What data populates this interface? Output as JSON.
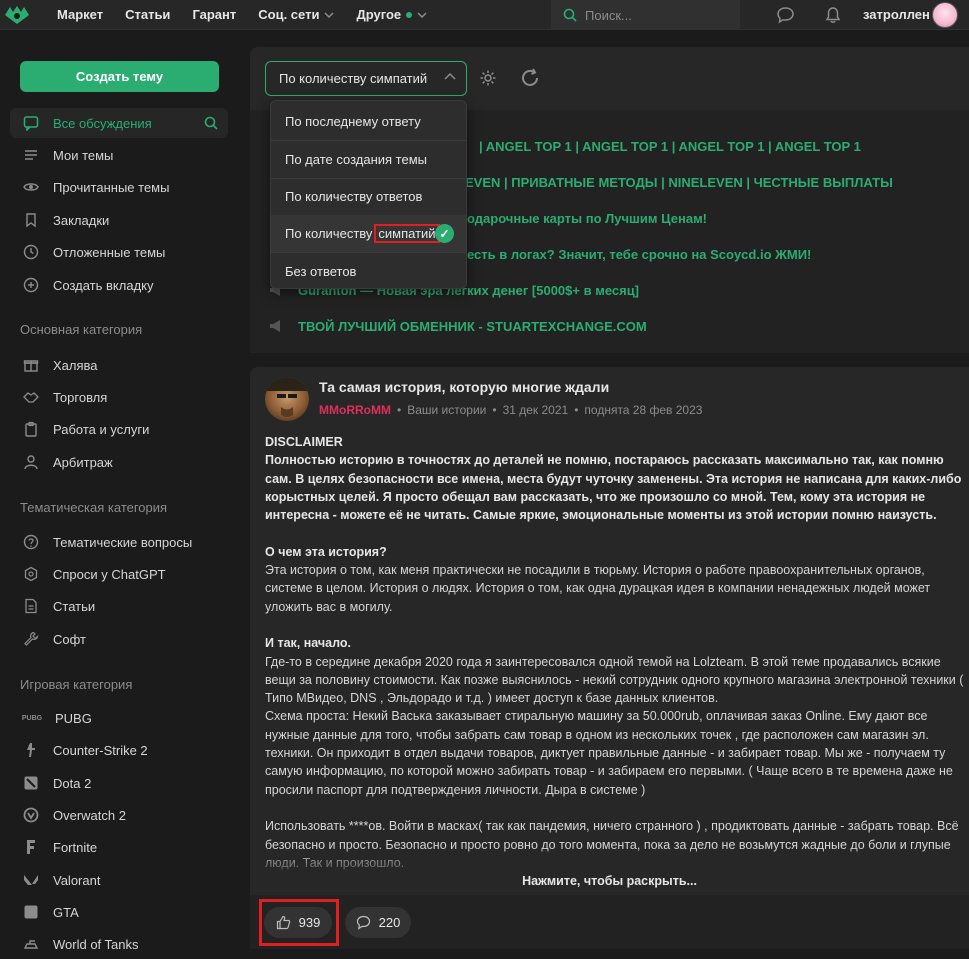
{
  "header": {
    "nav": [
      {
        "label": "Маркет"
      },
      {
        "label": "Статьи"
      },
      {
        "label": "Гарант"
      },
      {
        "label": "Соц. сети"
      },
      {
        "label": "Другое"
      }
    ],
    "search_placeholder": "Поиск...",
    "username": "затроллен"
  },
  "sidebar": {
    "create_label": "Создать тему",
    "items": [
      {
        "label": "Все обсуждения",
        "icon": "chat-icon"
      },
      {
        "label": "Мои темы",
        "icon": "list-icon"
      },
      {
        "label": "Прочитанные темы",
        "icon": "eye-icon"
      },
      {
        "label": "Закладки",
        "icon": "bookmark-icon"
      },
      {
        "label": "Отложенные темы",
        "icon": "clock-icon"
      },
      {
        "label": "Создать вкладку",
        "icon": "plus-circle-icon"
      }
    ],
    "section_main": "Основная категория",
    "main_items": [
      {
        "label": "Халява"
      },
      {
        "label": "Торговля"
      },
      {
        "label": "Работа и услуги"
      },
      {
        "label": "Арбитраж"
      }
    ],
    "section_theme": "Тематическая категория",
    "theme_items": [
      {
        "label": "Тематические вопросы"
      },
      {
        "label": "Спроси у ChatGPT"
      },
      {
        "label": "Статьи"
      },
      {
        "label": "Софт"
      }
    ],
    "section_games": "Игровая категория",
    "game_items": [
      {
        "label": "PUBG"
      },
      {
        "label": "Counter-Strike 2"
      },
      {
        "label": "Dota 2"
      },
      {
        "label": "Overwatch 2"
      },
      {
        "label": "Fortnite"
      },
      {
        "label": "Valorant"
      },
      {
        "label": "GTA"
      },
      {
        "label": "World of Tanks"
      }
    ]
  },
  "filter": {
    "selected": "По количеству симпатий",
    "options": [
      {
        "label": "По последнему ответу"
      },
      {
        "label": "По дате создания темы"
      },
      {
        "label": "По количеству ответов"
      },
      {
        "label_prefix": "По количеству ",
        "label_highlight": "симпатий"
      },
      {
        "label": "Без ответов"
      }
    ]
  },
  "ads": [
    "| ANGEL TOP 1 | ANGEL TOP 1 | ANGEL TOP 1 | ANGEL TOP 1",
    "EVEN | ПРИВАТНЫЕ МЕТОДЫ | NINELEVEN | ЧЕСТНЫЕ ВЫПЛАТЫ",
    "одарочные карты по Лучшим Ценам!",
    "есть в логах? Значит, тебе срочно на Scoycd.io ЖМИ!",
    "Guranton — Новая эра легких денег [5000$+ в месяц]",
    "ТВОЙ ЛУЧШИЙ ОБМЕННИК - STUARTEXCHANGE.COM"
  ],
  "post": {
    "title": "Та самая история, которую многие ждали",
    "author": "MMoRRoMM",
    "section": "Ваши истории",
    "date": "31 дек 2021",
    "raised": "поднята 28 фев 2023",
    "disclaimer_title": "DISCLAIMER",
    "disclaimer_text": "Полностью историю в точностях до деталей не помню, постараюсь рассказать максимально так, как помню сам. В целях безопасности все имена, места будут чуточку заменены. Эта история не написана для каких-либо корыстных целей. Я просто обещал вам рассказать, что же произошло со мной. Тем, кому эта история не интересна - можете её не читать. Самые яркие, эмоциональные моменты из этой истории помню наизусть.",
    "about_title": "О чем эта история?",
    "about_text": "Эта история о том, как меня практически не посадили в тюрьму. История о работе правоохранительных органов, системе в целом. История о людях. История о том, как одна дурацкая идея в компании ненадежных людей может уложить вас в могилу.",
    "start_title": "И так, начало.",
    "start_text1": "Где-то в середине декабря 2020 года я заинтересовался одной темой на Lolzteam. В этой теме продавались всякие вещи за половину стоимости. Как позже выяснилось - некий сотрудник одного крупного магазина электронной техники ( Типо МВидео, DNS , Эльдорадо и т.д. ) имеет доступ к базе данных клиентов.",
    "start_text2": "Схема проста: Некий Васька заказывает стиральную машину за 50.000rub, оплачивая заказ Online. Ему дают все нужные данные для того, чтобы забрать сам товар в одном из нескольких точек , где расположен сам магазин эл. техники. Он приходит в отдел выдачи товаров, диктует правильные данные - и забирает товар. Мы же - получаем ту самую информацию, по которой можно забирать товар - и забираем его первыми. ( Чаще всего в те времена даже не просили паспорт для подтверждения личности. Дыра в системе )",
    "use_text": "Использовать ****ов. Войти в масках( так как пандемия, ничего странного ) , продиктовать данные - забрать товар. Всё безопасно и просто. Безопасно и просто ровно до того момента, пока за дело не возьмутся жадные до боли и глупые люди. Так и произошло.",
    "reveal": "Нажмите, чтобы раскрыть...",
    "likes": "939",
    "comments": "220"
  }
}
